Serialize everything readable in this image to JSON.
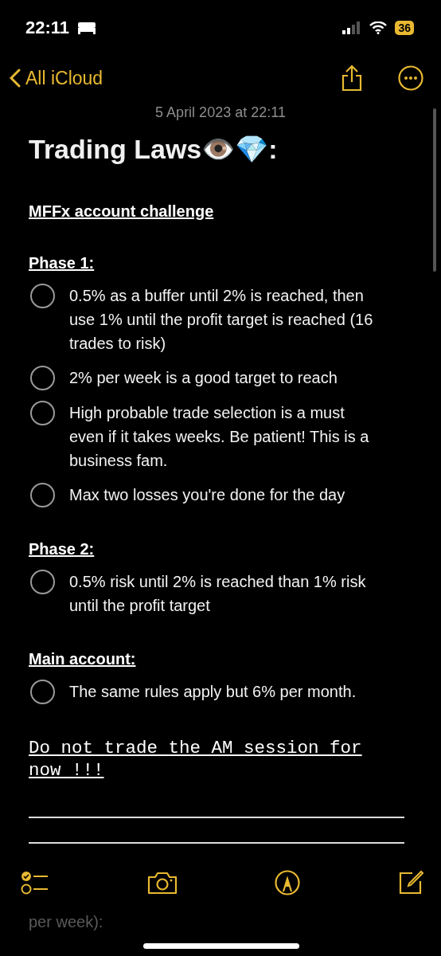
{
  "status_bar": {
    "time": "22:11",
    "battery": "36"
  },
  "nav": {
    "back": "All iCloud"
  },
  "note": {
    "date": "5 April 2023 at 22:11",
    "title": "Trading Laws👁️💎:",
    "sections": [
      {
        "kind": "heading",
        "text": "MFFx account challenge"
      },
      {
        "kind": "heading",
        "text": "Phase 1:",
        "items": [
          {
            "text": "0.5% as a buffer until 2% is reached, then use 1% until the profit target is reached (16 trades to risk)",
            "checked": false
          },
          {
            "text": "2% per week is a good target to reach",
            "checked": false
          },
          {
            "text": "High probable trade selection is a must even if it takes weeks. Be patient! This is a business fam.",
            "checked": false
          },
          {
            "text": "Max two losses you're done for the day",
            "checked": false
          }
        ]
      },
      {
        "kind": "heading",
        "text": "Phase 2:",
        "items": [
          {
            "text": "0.5% risk until 2% is reached than 1% risk until the profit target",
            "checked": false
          }
        ]
      },
      {
        "kind": "heading",
        "text": "Main account:",
        "items": [
          {
            "text": "The same rules apply but 6% per month.",
            "checked": false
          }
        ]
      },
      {
        "kind": "mono",
        "text": "Do not trade the AM session for now !!!"
      },
      {
        "kind": "rules"
      },
      {
        "kind": "faded",
        "text": "per week):"
      }
    ]
  }
}
